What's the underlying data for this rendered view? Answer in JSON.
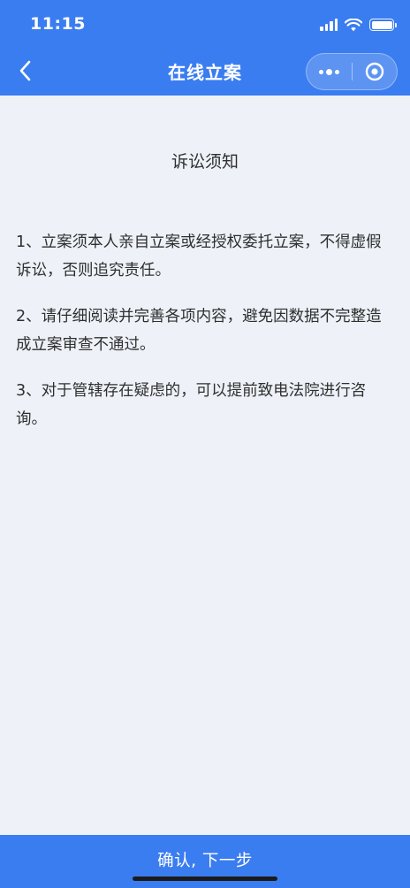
{
  "status_bar": {
    "time": "11:15",
    "icons": [
      "signal-icon",
      "wifi-icon",
      "battery-icon"
    ]
  },
  "nav": {
    "back_icon": "chevron-left-icon",
    "title": "在线立案",
    "capsule": {
      "more_icon": "more-dots-icon",
      "close_icon": "target-circle-icon"
    }
  },
  "notice": {
    "title": "诉讼须知",
    "items": [
      "1、立案须本人亲自立案或经授权委托立案，不得虚假诉讼，否则追究责任。",
      "2、请仔细阅读并完善各项内容，避免因数据不完整造成立案审查不通过。",
      "3、对于管辖存在疑虑的，可以提前致电法院进行咨询。"
    ]
  },
  "footer": {
    "confirm_label": "确认, 下一步"
  },
  "colors": {
    "primary": "#3a7df0",
    "background": "#eef2f8",
    "text": "#2f2f2f"
  }
}
